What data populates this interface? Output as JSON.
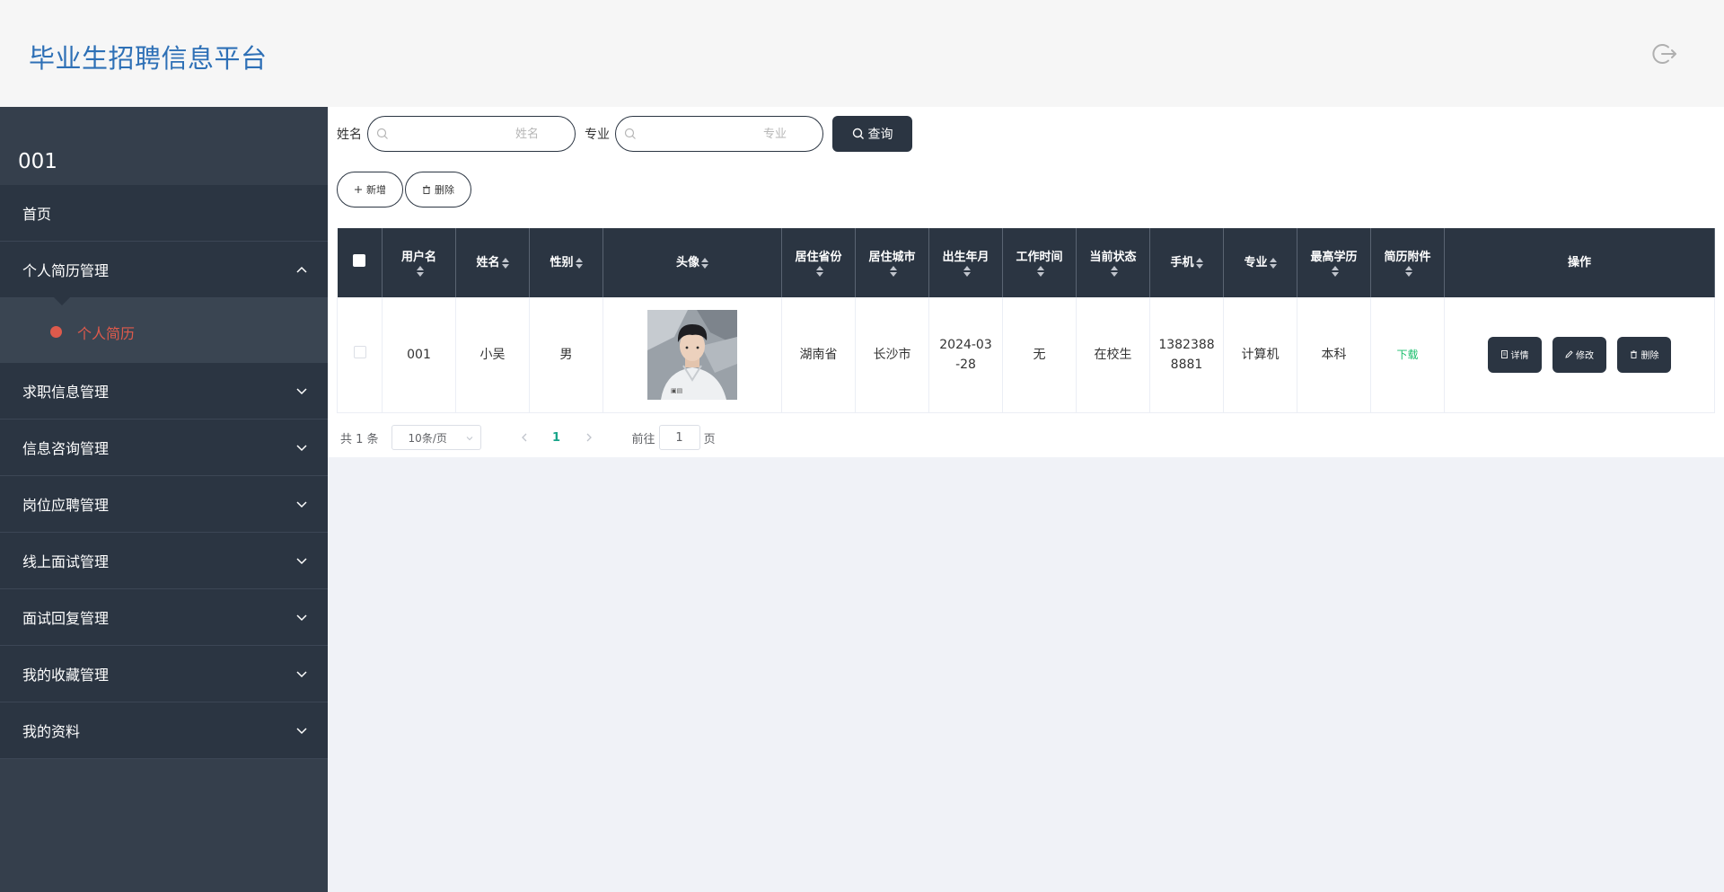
{
  "header": {
    "title": "毕业生招聘信息平台",
    "logout_icon": "logout-icon"
  },
  "sidebar": {
    "username": "001",
    "items": [
      {
        "label": "首页"
      },
      {
        "label": "个人简历管理"
      },
      {
        "label": "求职信息管理"
      },
      {
        "label": "信息咨询管理"
      },
      {
        "label": "岗位应聘管理"
      },
      {
        "label": "线上面试管理"
      },
      {
        "label": "面试回复管理"
      },
      {
        "label": "我的收藏管理"
      },
      {
        "label": "我的资料"
      }
    ],
    "active_sub": {
      "label": "个人简历",
      "color": "#de5a4c"
    }
  },
  "search": {
    "name_label": "姓名",
    "name_placeholder": "姓名",
    "major_label": "专业",
    "major_placeholder": "专业",
    "query_label": "查询"
  },
  "actions": {
    "add_label": "新增",
    "delete_label": "删除"
  },
  "table": {
    "headers": {
      "username": "用户名",
      "name": "姓名",
      "gender": "性别",
      "avatar": "头像",
      "province": "居住省份",
      "city": "居住城市",
      "birth": "出生年月",
      "work_time": "工作时间",
      "status": "当前状态",
      "phone": "手机",
      "major": "专业",
      "education": "最高学历",
      "resume": "简历附件",
      "ops": "操作"
    },
    "rows": [
      {
        "username": "001",
        "name": "小吴",
        "gender": "男",
        "province": "湖南省",
        "city": "长沙市",
        "birth_line1": "2024-03",
        "birth_line2": "-28",
        "work_time": "无",
        "status": "在校生",
        "phone_line1": "1382388",
        "phone_line2": "8881",
        "major": "计算机",
        "education": "本科",
        "resume_link": "下载",
        "detail_label": "详情",
        "edit_label": "修改",
        "delete_label": "删除"
      }
    ]
  },
  "pagination": {
    "total": "共 1 条",
    "page_size": "10条/页",
    "current_page": "1",
    "goto_prefix": "前往",
    "goto_value": "1",
    "goto_suffix": "页"
  },
  "colors": {
    "dark": "#2b3542",
    "accent": "#de5a4c",
    "title": "#2e70b6",
    "link": "#19be6b"
  }
}
